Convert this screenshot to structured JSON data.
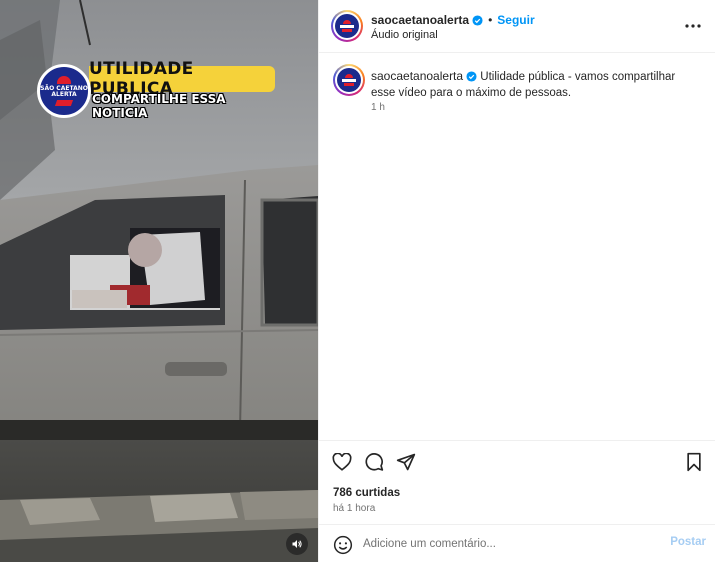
{
  "media": {
    "banner_title": "UTILIDADE PUBLICA",
    "banner_subtitle": "COMPARTILHE ESSA NOTICIA",
    "logo_text_line1": "SÃO CAETANO",
    "logo_text_line2": "ALERTA",
    "mute_icon": "speaker-icon"
  },
  "header": {
    "username": "saocaetanoalerta",
    "verified": true,
    "separator": "•",
    "follow_label": "Seguir",
    "audio_label": "Áudio original",
    "more_icon": "more-horizontal-icon"
  },
  "caption": {
    "username": "saocaetanoalerta",
    "text": "Utilidade pública - vamos compartilhar esse vídeo para o máximo de pessoas.",
    "time": "1 h"
  },
  "actions": {
    "icons": [
      "heart-icon",
      "comment-icon",
      "share-icon",
      "bookmark-icon"
    ],
    "likes": "786 curtidas",
    "posted_ago": "há 1 hora"
  },
  "comment": {
    "placeholder": "Adicione um comentário...",
    "post_label": "Postar",
    "emoji_icon": "emoji-icon"
  },
  "colors": {
    "accent": "#0095f6",
    "banner_yellow": "#f5d23a",
    "logo_blue": "#1b2a8c",
    "logo_red": "#e01e2b"
  }
}
